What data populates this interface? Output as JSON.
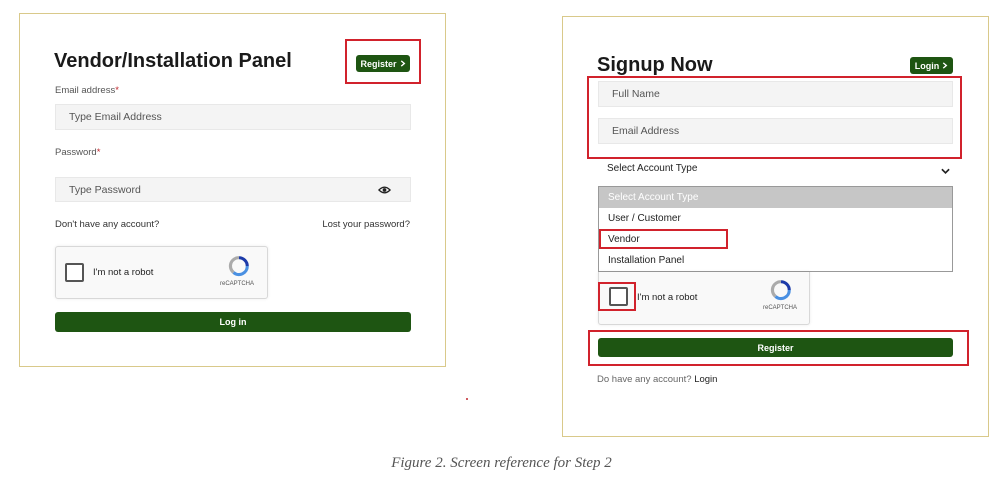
{
  "left_panel": {
    "title": "Vendor/Installation Panel",
    "register_button": "Register",
    "email_label": "Email address",
    "required_mark": "*",
    "email_placeholder": "Type Email Address",
    "password_label": "Password",
    "password_placeholder": "Type Password",
    "no_account_text": "Don't have any account?",
    "lost_password_link": "Lost your password?",
    "recaptcha_label": "I'm not a robot",
    "recaptcha_brand": "reCAPTCHA",
    "login_button": "Log in"
  },
  "right_panel": {
    "title": "Signup Now",
    "login_button": "Login",
    "full_name_placeholder": "Full Name",
    "email_placeholder": "Email Address",
    "account_type_select": "Select Account Type",
    "account_type_options": [
      "Select Account Type",
      "User / Customer",
      "Vendor",
      "Installation Panel"
    ],
    "recaptcha_label": "I'm not a robot",
    "recaptcha_brand": "reCAPTCHA",
    "register_button": "Register",
    "have_account_text": "Do have any account?",
    "login_link": "Login"
  },
  "caption": "Figure 2. Screen reference for Step 2",
  "colors": {
    "button_green": "#1e5512",
    "highlight_red": "#d1222c",
    "panel_border": "#d9c98a"
  },
  "icons": [
    "chevron-right-icon",
    "eye-icon",
    "chevron-down-icon",
    "recaptcha-logo-icon"
  ]
}
